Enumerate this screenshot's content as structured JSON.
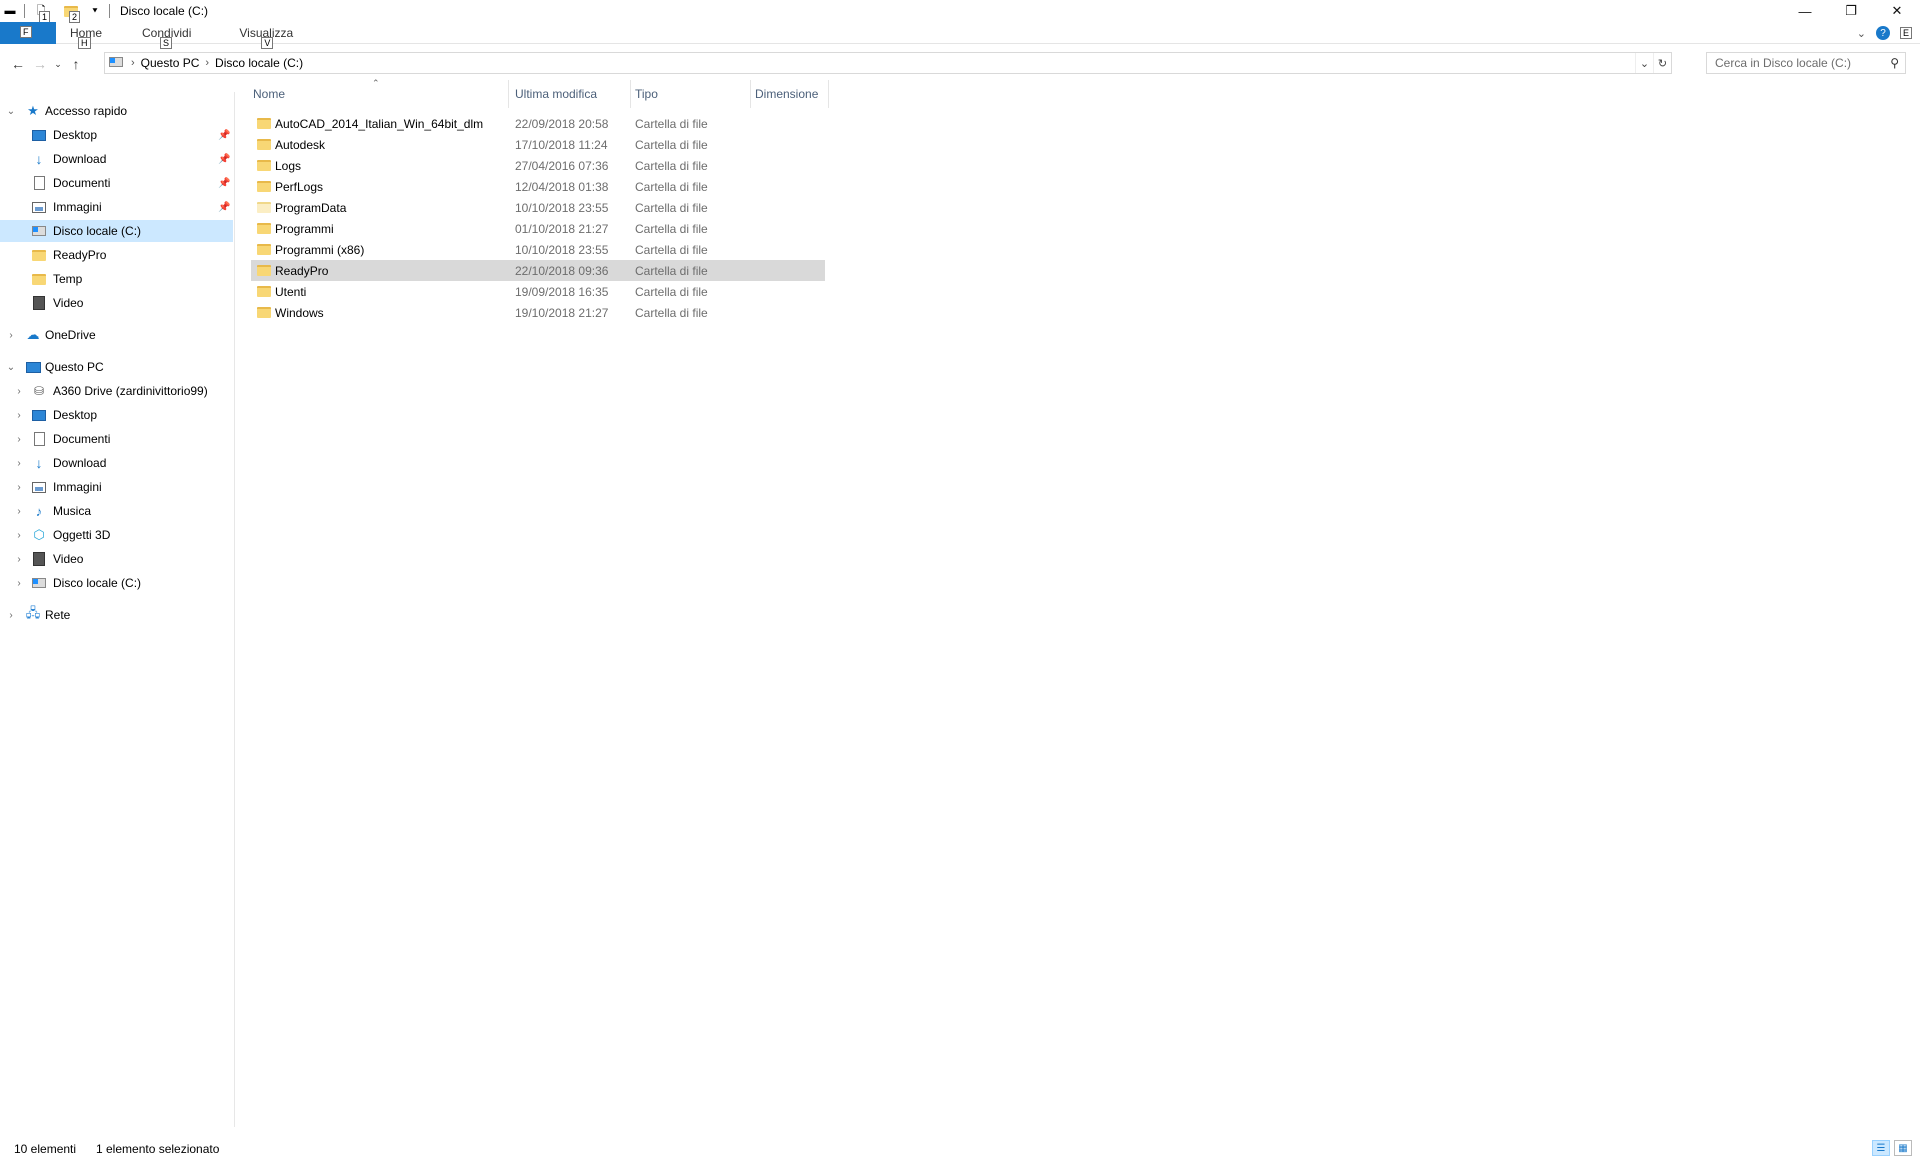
{
  "window": {
    "title": "Disco locale (C:)",
    "controls": {
      "minimize": "—",
      "restore": "❐",
      "close": "✕"
    }
  },
  "quick_access_toolbar": {
    "keytips": [
      "1",
      "2"
    ]
  },
  "ribbon": {
    "file_tab": "File",
    "file_keytip": "F",
    "tabs": [
      {
        "label": "Home",
        "keytip": "H"
      },
      {
        "label": "Condividi",
        "keytip": "S"
      },
      {
        "label": "Visualizza",
        "keytip": "V"
      }
    ],
    "help_keytip": "E"
  },
  "address_bar": {
    "breadcrumbs": [
      "Questo PC",
      "Disco locale (C:)"
    ]
  },
  "search": {
    "placeholder": "Cerca in Disco locale (C:)"
  },
  "sidebar": {
    "quick_access": {
      "label": "Accesso rapido",
      "items": [
        {
          "label": "Desktop",
          "icon": "desktop-icon",
          "pinned": true
        },
        {
          "label": "Download",
          "icon": "download-icon",
          "pinned": true
        },
        {
          "label": "Documenti",
          "icon": "documents-icon",
          "pinned": true
        },
        {
          "label": "Immagini",
          "icon": "pictures-icon",
          "pinned": true
        },
        {
          "label": "Disco locale (C:)",
          "icon": "drive-icon",
          "pinned": false,
          "selected": true
        },
        {
          "label": "ReadyPro",
          "icon": "folder-icon",
          "pinned": false
        },
        {
          "label": "Temp",
          "icon": "folder-icon",
          "pinned": false
        },
        {
          "label": "Video",
          "icon": "video-icon",
          "pinned": false
        }
      ]
    },
    "onedrive": {
      "label": "OneDrive"
    },
    "this_pc": {
      "label": "Questo PC",
      "items": [
        {
          "label": "A360 Drive (zardinivittorio99)",
          "icon": "a360-drive-icon"
        },
        {
          "label": "Desktop",
          "icon": "desktop-icon"
        },
        {
          "label": "Documenti",
          "icon": "documents-icon"
        },
        {
          "label": "Download",
          "icon": "download-icon"
        },
        {
          "label": "Immagini",
          "icon": "pictures-icon"
        },
        {
          "label": "Musica",
          "icon": "music-icon"
        },
        {
          "label": "Oggetti 3D",
          "icon": "3d-objects-icon"
        },
        {
          "label": "Video",
          "icon": "video-icon"
        },
        {
          "label": "Disco locale (C:)",
          "icon": "drive-icon"
        }
      ]
    },
    "network": {
      "label": "Rete"
    }
  },
  "file_list": {
    "columns": [
      "Nome",
      "Ultima modifica",
      "Tipo",
      "Dimensione"
    ],
    "rows": [
      {
        "name": "AutoCAD_2014_Italian_Win_64bit_dlm",
        "modified": "22/09/2018 20:58",
        "type": "Cartella di file"
      },
      {
        "name": "Autodesk",
        "modified": "17/10/2018 11:24",
        "type": "Cartella di file"
      },
      {
        "name": "Logs",
        "modified": "27/04/2016 07:36",
        "type": "Cartella di file"
      },
      {
        "name": "PerfLogs",
        "modified": "12/04/2018 01:38",
        "type": "Cartella di file"
      },
      {
        "name": "ProgramData",
        "modified": "10/10/2018 23:55",
        "type": "Cartella di file",
        "hidden": true
      },
      {
        "name": "Programmi",
        "modified": "01/10/2018 21:27",
        "type": "Cartella di file"
      },
      {
        "name": "Programmi (x86)",
        "modified": "10/10/2018 23:55",
        "type": "Cartella di file"
      },
      {
        "name": "ReadyPro",
        "modified": "22/10/2018 09:36",
        "type": "Cartella di file",
        "highlighted": true
      },
      {
        "name": "Utenti",
        "modified": "19/09/2018 16:35",
        "type": "Cartella di file"
      },
      {
        "name": "Windows",
        "modified": "19/10/2018 21:27",
        "type": "Cartella di file"
      }
    ]
  },
  "status_bar": {
    "item_count": "10 elementi",
    "selection": "1 elemento selezionato"
  },
  "colors": {
    "accent": "#1979ca",
    "selection": "#cce8ff",
    "hover_row": "#d9d9d9"
  }
}
